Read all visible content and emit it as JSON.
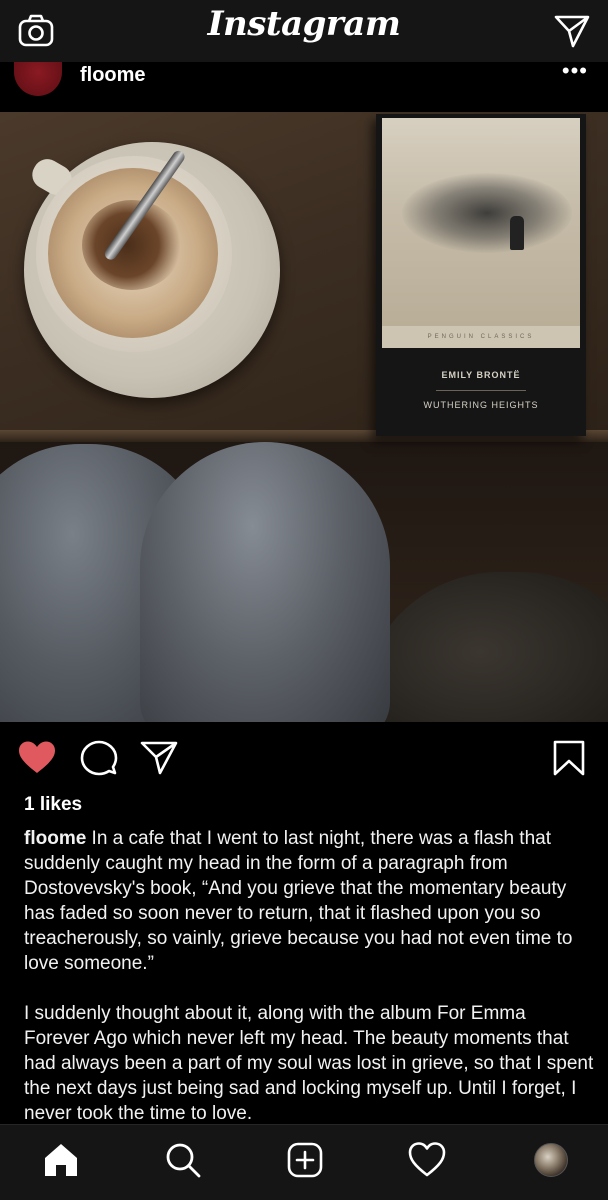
{
  "topbar": {
    "logo": "Instagram",
    "camera_icon": "camera-icon",
    "direct_icon": "paper-plane-icon"
  },
  "post": {
    "username": "floome",
    "more_icon": "more-options-icon",
    "photo": {
      "book_author": "EMILY BRONTË",
      "book_title": "WUTHERING HEIGHTS",
      "book_publisher": "PENGUIN   CLASSICS"
    },
    "likes": "1 likes",
    "caption_username": "floome",
    "caption_p1": " In a cafe that I went to last night, there was a flash that suddenly caught my head in the form of a paragraph from Dostovevsky's book, “And you grieve that the momentary beauty has faded so soon never to return, that it flashed upon you so treacherously, so vainly, grieve because you had not even time to love someone.”",
    "caption_p2": "I suddenly thought about it, along with the album For Emma Forever Ago which never left my head. The beauty moments that had always been a part of my soul was lost in grieve, so that I spent the next days just being sad and locking myself up. Until I forget, I never took the time to love."
  },
  "colors": {
    "liked_heart": "#e0595f",
    "background": "#000000",
    "bar": "#151515"
  },
  "bottom_nav": [
    "home-icon",
    "search-icon",
    "new-post-icon",
    "activity-heart-icon",
    "profile-avatar"
  ]
}
